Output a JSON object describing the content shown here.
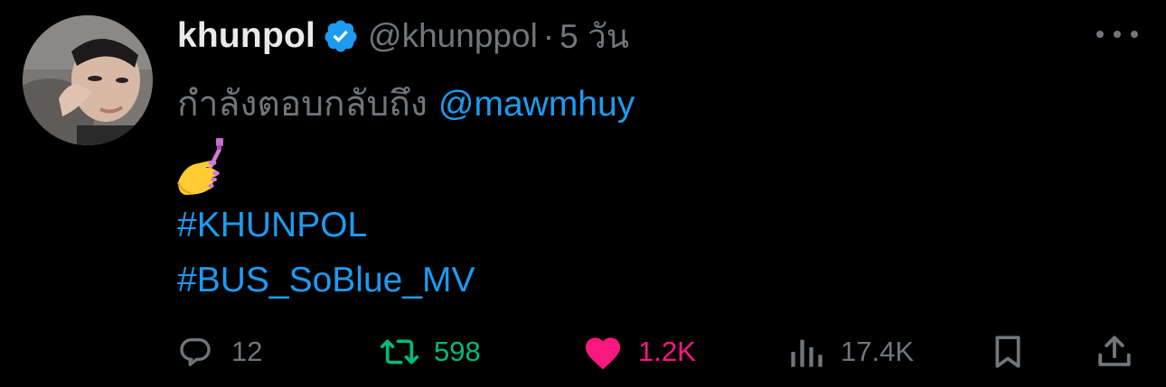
{
  "author": {
    "display_name": "khunpol",
    "handle": "@khunppol",
    "separator": "·",
    "time": "5 วัน",
    "verified": true,
    "avatar": "avatar-photo"
  },
  "reply_to": {
    "prefix": "กำลังตอบกลับถึง",
    "mention": "@mawmhuy"
  },
  "body": {
    "emoji": "nail-polish-emoji",
    "hashtags": [
      "#KHUNPOL",
      "#BUS_SoBlue_MV"
    ]
  },
  "actions": {
    "reply_count": "12",
    "retweet_count": "598",
    "like_count": "1.2K",
    "views_count": "17.4K"
  },
  "colors": {
    "background": "#000000",
    "primary_text": "#e7e9ea",
    "secondary_text": "#71767b",
    "link": "#1d9bf0",
    "retweet": "#00ba7c",
    "like": "#f91880",
    "verified_badge": "#1d9bf0"
  },
  "icons": [
    "verified-badge-icon",
    "more-icon",
    "reply-icon",
    "retweet-icon",
    "like-icon",
    "views-icon",
    "bookmark-icon",
    "share-icon"
  ]
}
